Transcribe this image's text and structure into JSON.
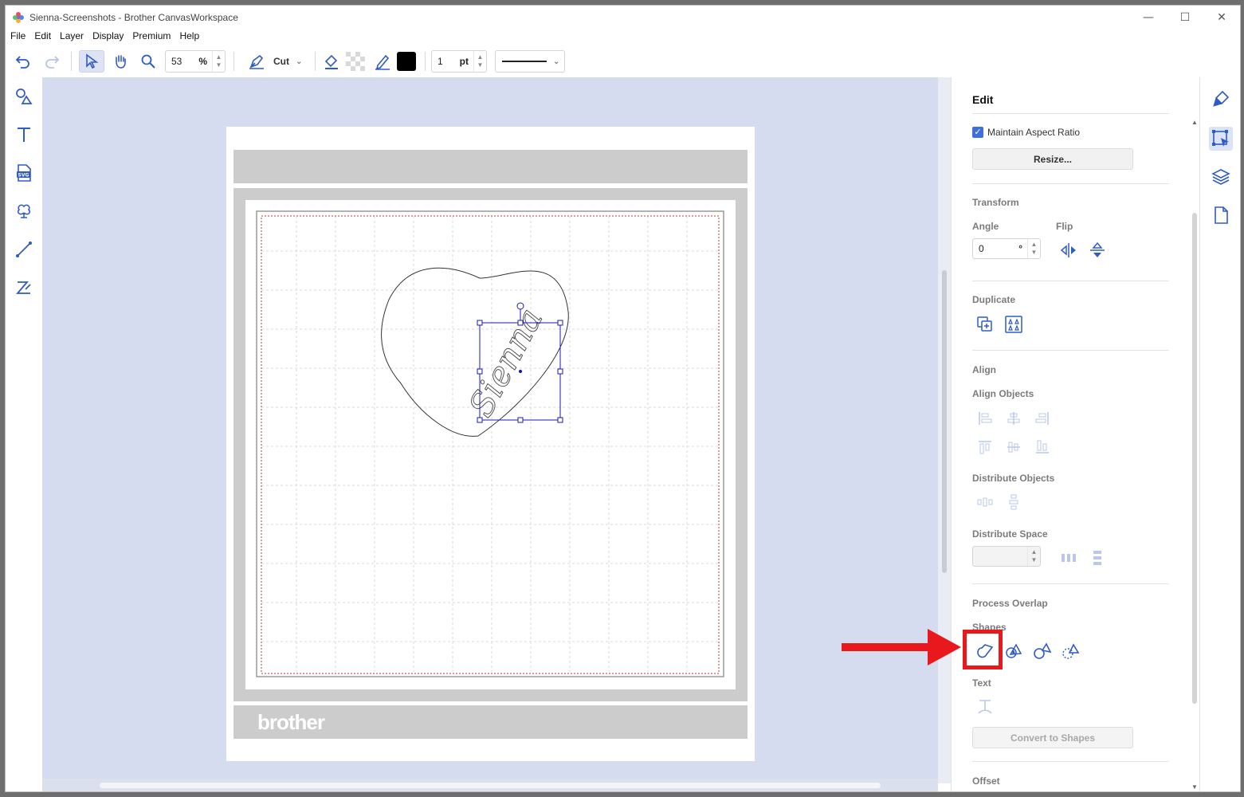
{
  "window": {
    "title": "Sienna-Screenshots - Brother CanvasWorkspace",
    "minimize": "—",
    "maximize": "☐",
    "close": "✕"
  },
  "menu": [
    "File",
    "Edit",
    "Layer",
    "Display",
    "Premium",
    "Help"
  ],
  "toolbar": {
    "zoom_value": "53",
    "zoom_unit": "%",
    "mode_label": "Cut",
    "line_width_value": "1",
    "line_width_unit": "pt",
    "stroke_color": "#000000"
  },
  "canvas": {
    "brand_text": "brother",
    "text_object": "Sienna"
  },
  "edit_panel": {
    "title": "Edit",
    "maintain_aspect_ratio_label": "Maintain Aspect Ratio",
    "maintain_aspect_ratio_checked": true,
    "resize_label": "Resize...",
    "transform_label": "Transform",
    "angle_label": "Angle",
    "angle_value": "0",
    "angle_unit": "°",
    "flip_label": "Flip",
    "duplicate_label": "Duplicate",
    "align_label": "Align",
    "align_objects_label": "Align Objects",
    "distribute_objects_label": "Distribute Objects",
    "distribute_space_label": "Distribute Space",
    "process_overlap_label": "Process Overlap",
    "shapes_label": "Shapes",
    "text_label": "Text",
    "convert_to_shapes_label": "Convert to Shapes",
    "offset_label": "Offset"
  },
  "colors": {
    "accent": "#3f6fd8",
    "icon_blue": "#2f5bc4",
    "canvas_bg": "#d5dcef",
    "mat_gray": "#cccccc",
    "annotation_red": "#e8181c"
  }
}
